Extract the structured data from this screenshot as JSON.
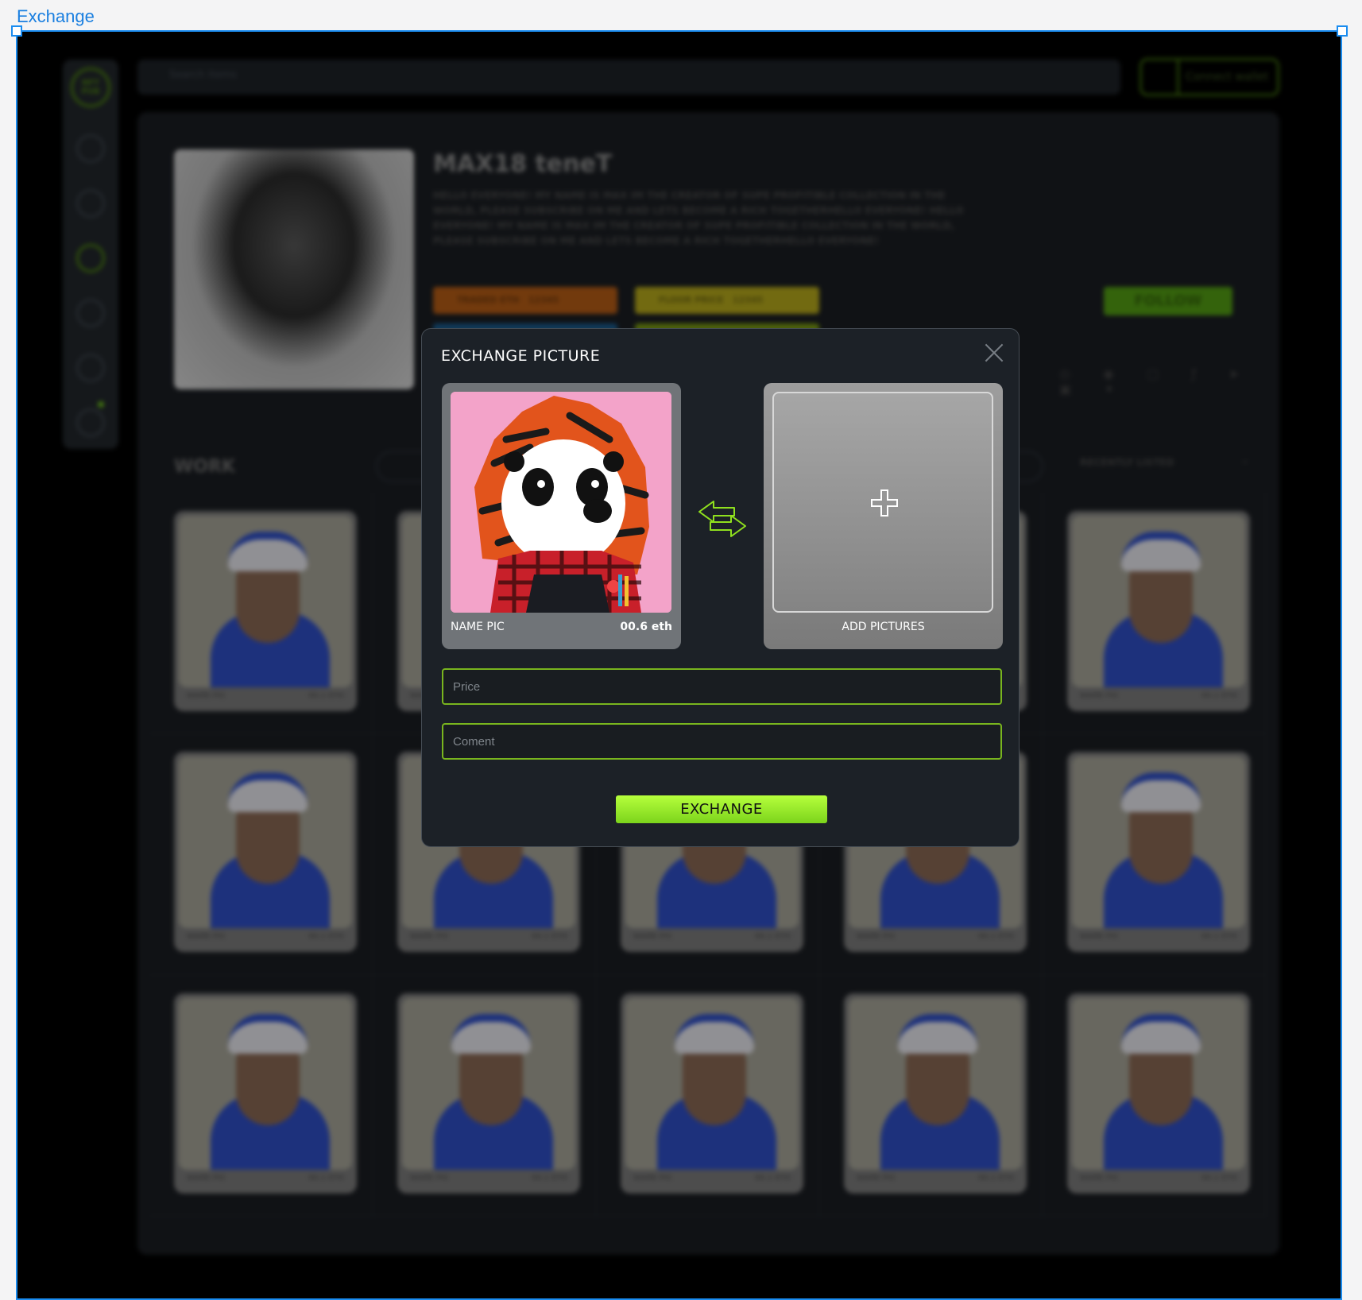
{
  "frame": {
    "label": "Exchange"
  },
  "app": {
    "logo_text": "NFT PUB",
    "search_placeholder": "Search items",
    "wallet_label": "Connect wallet",
    "profile": {
      "name": "MAX18 teneT",
      "bio": "HELLO EVERYONE! MY NAME IS MAX IM THE CREATOR OF SUPE PROFITIBLE COLLECTION IN THE WORLD, PLEASE SUBSCRIBE ON ME AND LETS BECOME A RICH TOGETHERHELLO EVERYONE! HELLO EVERYONE! MY NAME IS MAX IM THE CREATOR OF SUPE PROFITIBLE COLLECTION IN THE WORLD, PLEASE SUBSCRIBE ON ME AND LETS BECOME A RICH TOGETHERHELLO EVERYONE!",
      "stats": [
        {
          "label": "TRADED ETH",
          "value": "12345"
        },
        {
          "label": "FLOOR PRICE",
          "value": "12345"
        }
      ],
      "follow_label": "FOLLOW"
    },
    "work": {
      "title": "WORK",
      "sort_label": "RECENTLY LISTED",
      "card_name": "NAME PIC",
      "card_price": "00.1 ETH"
    }
  },
  "modal": {
    "title": "EXCHANGE PICTURE",
    "item": {
      "name": "NAME PIC",
      "price": "00.6 eth"
    },
    "add_label": "ADD PICTURES",
    "price_placeholder": "Price",
    "comment_placeholder": "Coment",
    "button_label": "EXCHANGE"
  },
  "colors": {
    "accent": "#8fe01e",
    "modal_bg": "#1c2127",
    "frame_border": "#1a8cf0"
  }
}
